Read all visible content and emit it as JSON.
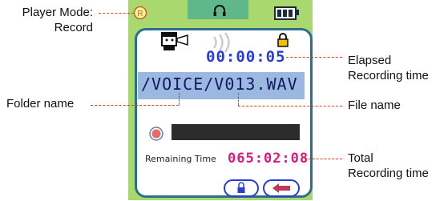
{
  "labels": {
    "player_mode_line1": "Player Mode:",
    "player_mode_line2": "Record",
    "folder_name": "Folder name",
    "elapsed_line1": "Elapsed",
    "elapsed_line2": "Recording time",
    "file_name": "File name",
    "total_line1": "Total",
    "total_line2": "Recording time"
  },
  "screen": {
    "elapsed_time": "00:00:05",
    "path": "/VOICE/V013.WAV",
    "remaining_label": "Remaining Time",
    "remaining_time": "065:02:08"
  },
  "icons": {
    "mode": "record-mode-icon",
    "headphones": "headphones-icon",
    "battery": "battery-icon",
    "person": "person-speaking-icon",
    "sound": "sound-waves-icon",
    "lock": "lock-icon",
    "record_dot": "record-dot-icon",
    "lock_button": "lock-button-icon",
    "back_button": "back-arrow-icon"
  },
  "colors": {
    "device_green": "#a9d96e",
    "screen_border": "#2a6f8c",
    "leader": "#e23a1a",
    "elapsed_time": "#2a3bd6",
    "remaining_time": "#d81b7f"
  }
}
